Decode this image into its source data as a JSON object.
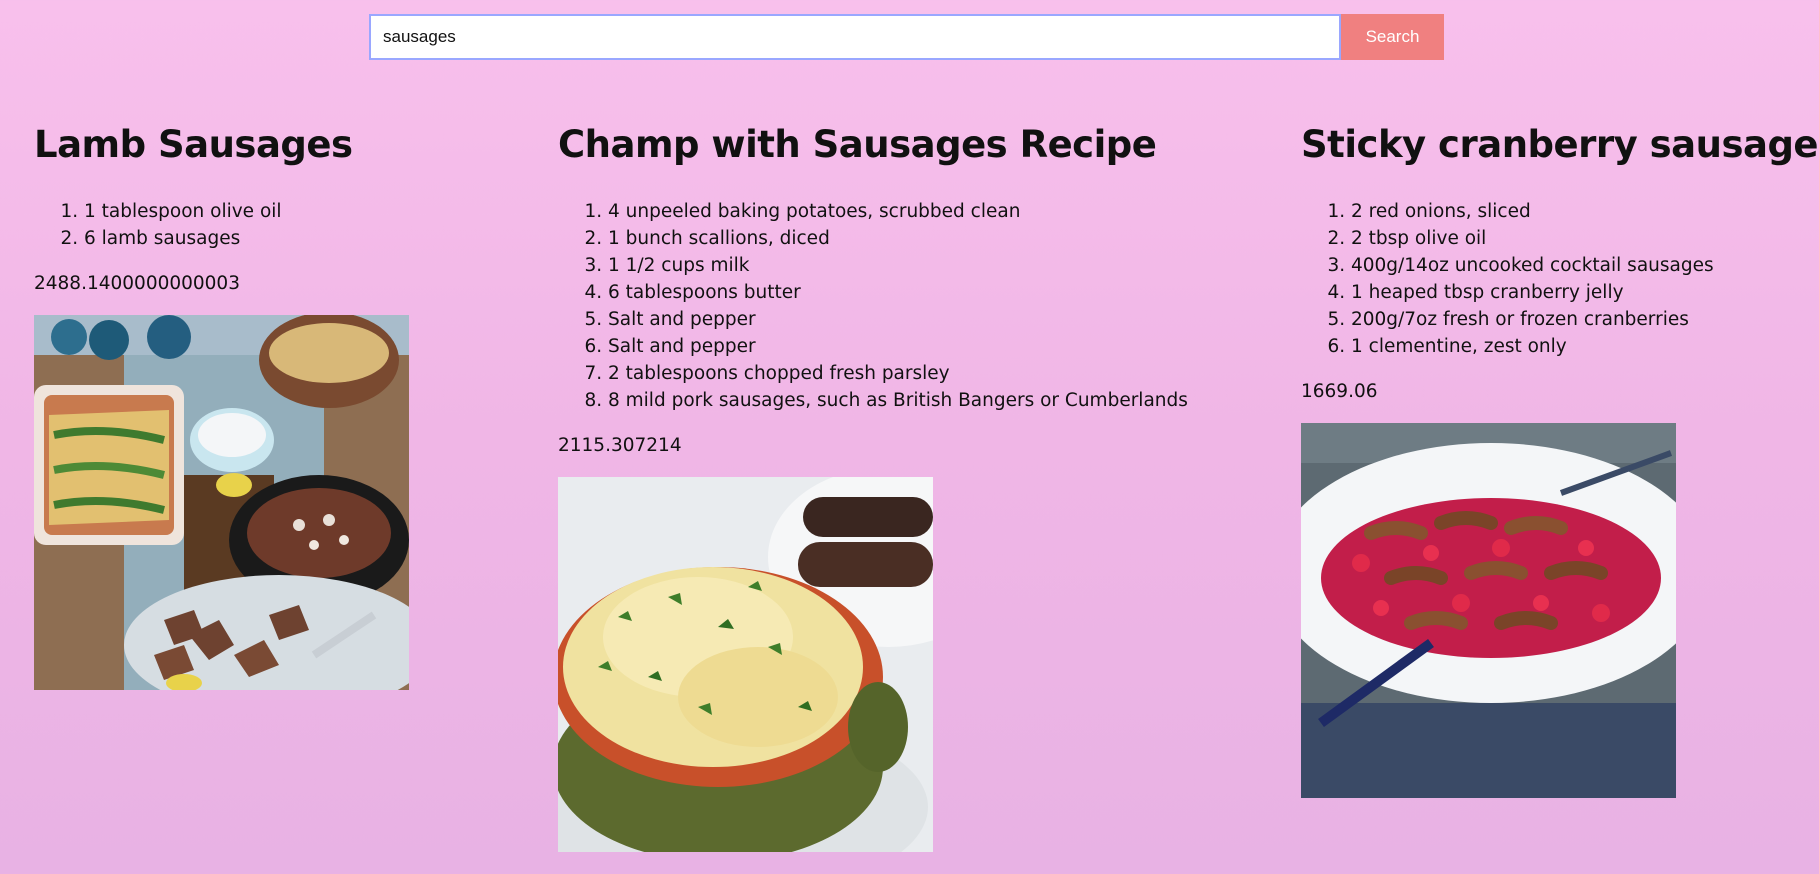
{
  "search": {
    "value": "sausages",
    "button_label": "Search"
  },
  "recipes": [
    {
      "title": "Lamb Sausages",
      "ingredients": [
        "1 tablespoon olive oil",
        "6 lamb sausages"
      ],
      "calories": "2488.1400000000003",
      "image": "lamb-sausages-table-spread"
    },
    {
      "title": "Champ with Sausages Recipe",
      "ingredients": [
        "4 unpeeled baking potatoes, scrubbed clean",
        "1 bunch scallions, diced",
        "1 1/2 cups milk",
        "6 tablespoons butter",
        "Salt and pepper",
        "Salt and pepper",
        "2 tablespoons chopped fresh parsley",
        "8 mild pork sausages, such as British Bangers or Cumberlands"
      ],
      "calories": "2115.307214",
      "image": "champ-mashed-potato-bowl"
    },
    {
      "title": "Sticky cranberry sausages",
      "ingredients": [
        "2 red onions, sliced",
        "2 tbsp olive oil",
        "400g/14oz uncooked cocktail sausages",
        "1 heaped tbsp cranberry jelly",
        "200g/7oz fresh or frozen cranberries",
        "1 clementine, zest only"
      ],
      "calories": "1669.06",
      "image": "cranberry-sausages-plate"
    }
  ],
  "colors": {
    "background_top": "#f8c0ec",
    "background_bottom": "#e8b2e4",
    "search_button": "#f08080",
    "input_border": "#9aa7ff"
  }
}
